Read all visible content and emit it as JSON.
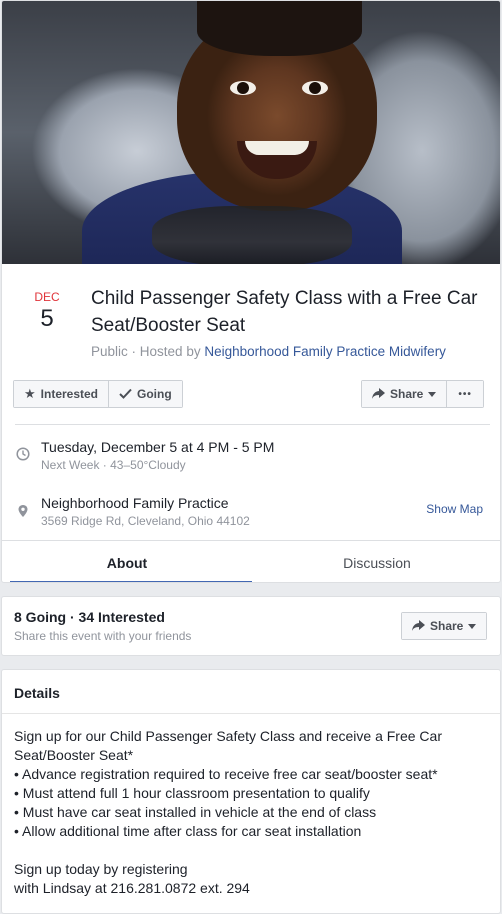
{
  "event": {
    "date_month": "DEC",
    "date_day": "5",
    "title": "Child Passenger Safety Class with a Free Car Seat/Booster Seat",
    "privacy": "Public",
    "hosted_by_prefix": "· Hosted by",
    "host": "Neighborhood Family Practice Midwifery"
  },
  "actions": {
    "interested_label": "Interested",
    "going_label": "Going",
    "share_label": "Share",
    "more_label": "•••"
  },
  "time": {
    "main": "Tuesday, December 5 at 4 PM - 5 PM",
    "sub": "Next Week · 43–50°Cloudy"
  },
  "location": {
    "name": "Neighborhood Family Practice",
    "address": "3569 Ridge Rd, Cleveland, Ohio 44102",
    "show_map_label": "Show Map"
  },
  "tabs": [
    {
      "label": "About",
      "active": true
    },
    {
      "label": "Discussion",
      "active": false
    }
  ],
  "attendance": {
    "summary": "8 Going · 34 Interested",
    "sub": "Share this event with your friends",
    "share_label": "Share"
  },
  "details": {
    "title": "Details",
    "lines": [
      "Sign up for our Child Passenger Safety Class and receive a Free Car Seat/Booster Seat*",
      "• Advance registration required to receive free car seat/booster seat*",
      "• Must attend full 1 hour classroom presentation to qualify",
      "• Must have car seat installed in vehicle at the end of class",
      "• Allow additional time after class for car seat installation"
    ],
    "closing_lines": [
      "Sign up today by registering",
      "with Lindsay at 216.281.0872 ext. 294"
    ]
  },
  "colors": {
    "accent": "#4267b2",
    "link": "#365899",
    "date_red": "#e0343a"
  },
  "icons": [
    "star-icon",
    "check-icon",
    "share-arrow-icon",
    "clock-icon",
    "map-pin-icon",
    "caret-down-icon"
  ]
}
